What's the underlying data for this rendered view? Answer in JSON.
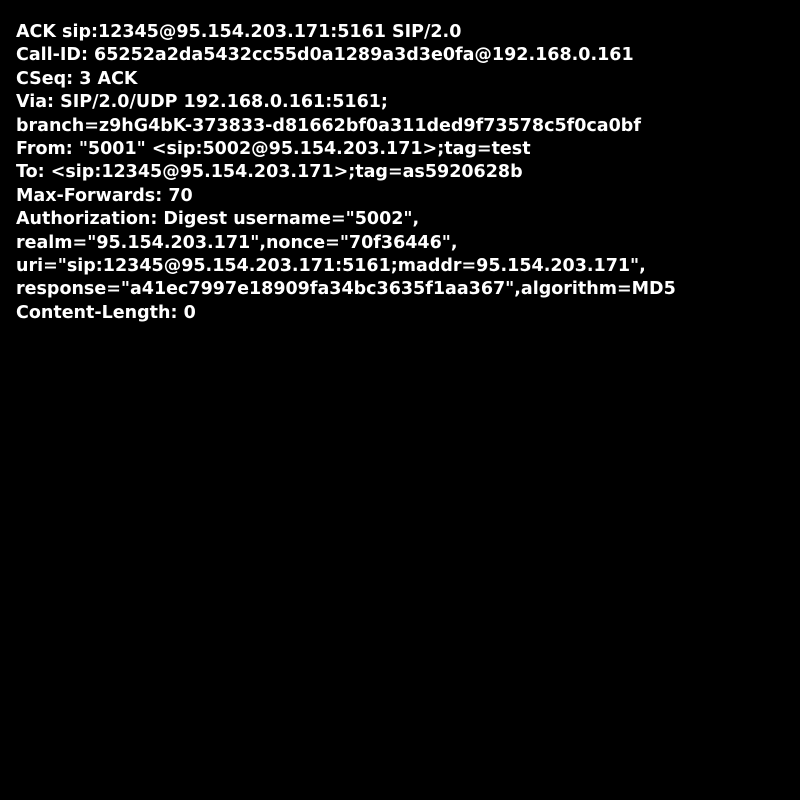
{
  "colors": {
    "background": "#000000",
    "text": "#ffffff"
  },
  "message": {
    "lines": [
      "ACK sip:12345@95.154.203.171:5161 SIP/2.0",
      "Call-ID: 65252a2da5432cc55d0a1289a3d3e0fa@192.168.0.161",
      "CSeq: 3 ACK",
      "Via: SIP/2.0/UDP 192.168.0.161:5161;",
      "branch=z9hG4bK-373833-d81662bf0a311ded9f73578c5f0ca0bf",
      "From: \"5001\" <sip:5002@95.154.203.171>;tag=test",
      "To: <sip:12345@95.154.203.171>;tag=as5920628b",
      "Max-Forwards: 70",
      "Authorization: Digest username=\"5002\",",
      "realm=\"95.154.203.171\",nonce=\"70f36446\",",
      "uri=\"sip:12345@95.154.203.171:5161;maddr=95.154.203.171\",",
      "response=\"a41ec7997e18909fa34bc3635f1aa367\",algorithm=MD5",
      "Content-Length: 0"
    ]
  }
}
